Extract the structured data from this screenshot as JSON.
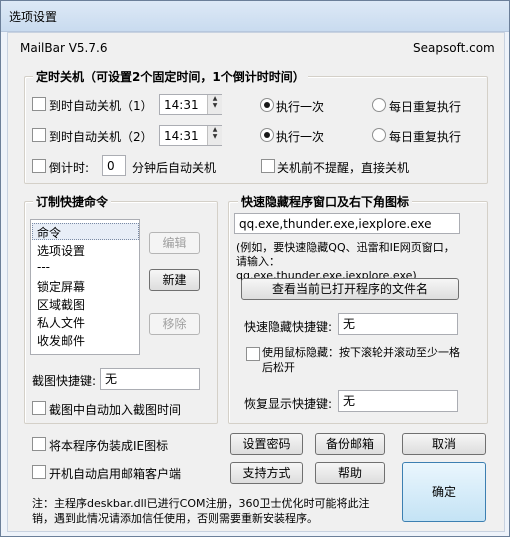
{
  "window": {
    "title": "选项设置"
  },
  "header": {
    "app_version": "MailBar V5.7.6",
    "site": "Seapsoft.com"
  },
  "shutdown": {
    "title": "定时关机（可设置2个固定时间，1个倒计时时间）",
    "row1": {
      "label": "到时自动关机（1）",
      "time": "14:31",
      "opt_once": "执行一次",
      "opt_daily": "每日重复执行"
    },
    "row2": {
      "label": "到时自动关机（2）",
      "time": "14:31",
      "opt_once": "执行一次",
      "opt_daily": "每日重复执行"
    },
    "countdown_label": "倒计时:",
    "countdown_value": "0",
    "countdown_suffix": "分钟后自动关机",
    "no_prompt_label": "关机前不提醒，直接关机"
  },
  "commands": {
    "title": "订制快捷命令",
    "items": [
      "命令",
      "选项设置",
      "---",
      "锁定屏幕",
      "区域截图",
      "私人文件",
      "收发邮件"
    ],
    "edit_button": "编辑",
    "new_button": "新建",
    "remove_button": "移除",
    "screenshot_hotkey_label": "截图快捷键:",
    "screenshot_hotkey_value": "无",
    "screenshot_auto_label": "截图中自动加入截图时间"
  },
  "hide": {
    "title": "快速隐藏程序窗口及右下角图标",
    "programs": "qq.exe,thunder.exe,iexplore.exe",
    "hint": "(例如，要快速隐藏QQ、迅雷和IE网页窗口，请输入：qq.exe,thunder.exe,iexplore.exe)",
    "view_button": "查看当前已打开程序的文件名",
    "hide_hotkey_label": "快速隐藏快捷键:",
    "hide_hotkey_value": "无",
    "mouse_hide_label": "使用鼠标隐藏：按下滚轮并滚动至少一格后松开",
    "restore_hotkey_label": "恢复显示快捷键:",
    "restore_hotkey_value": "无"
  },
  "bottom": {
    "ie_icon_label": "将本程序伪装成IE图标",
    "autostart_label": "开机自动启用邮箱客户端",
    "set_password": "设置密码",
    "backup_mail": "备份邮箱",
    "cancel": "取消",
    "support": "支持方式",
    "help": "帮助",
    "ok": "确定",
    "note": "注：主程序deskbar.dll已进行COM注册，360卫士优化时可能将此注销，遇到此情况请添加信任使用，否则需要重新安装程序。"
  }
}
